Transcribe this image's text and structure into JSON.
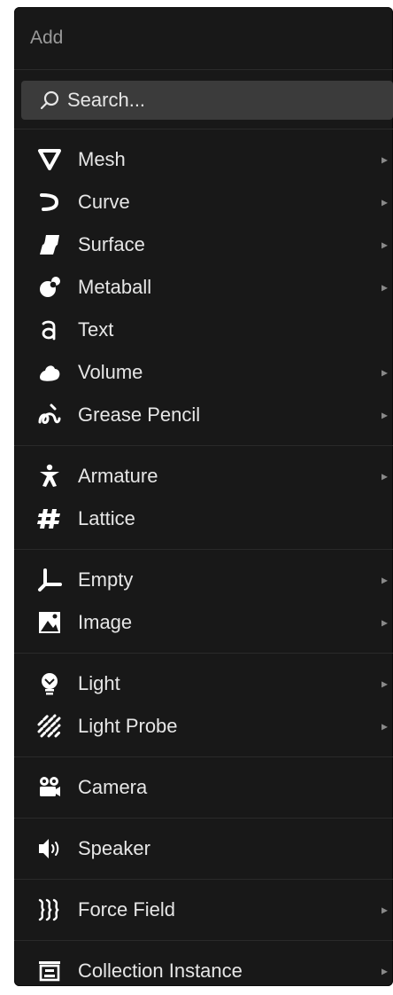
{
  "menu": {
    "title": "Add",
    "search_placeholder": "Search...",
    "groups": [
      {
        "items": [
          {
            "label": "Mesh",
            "icon": "mesh-icon",
            "arrow": "▸"
          },
          {
            "label": "Curve",
            "icon": "curve-icon",
            "arrow": "▸"
          },
          {
            "label": "Surface",
            "icon": "surface-icon",
            "arrow": "▸"
          },
          {
            "label": "Metaball",
            "icon": "metaball-icon",
            "arrow": "▸"
          },
          {
            "label": "Text",
            "icon": "text-icon",
            "arrow": ""
          },
          {
            "label": "Volume",
            "icon": "volume-icon",
            "arrow": "▸"
          },
          {
            "label": "Grease Pencil",
            "icon": "grease-pencil-icon",
            "arrow": "▸"
          }
        ]
      },
      {
        "items": [
          {
            "label": "Armature",
            "icon": "armature-icon",
            "arrow": "▸"
          },
          {
            "label": "Lattice",
            "icon": "lattice-icon",
            "arrow": ""
          }
        ]
      },
      {
        "items": [
          {
            "label": "Empty",
            "icon": "empty-icon",
            "arrow": "▸"
          },
          {
            "label": "Image",
            "icon": "image-icon",
            "arrow": "▸"
          }
        ]
      },
      {
        "items": [
          {
            "label": "Light",
            "icon": "light-icon",
            "arrow": "▸"
          },
          {
            "label": "Light Probe",
            "icon": "light-probe-icon",
            "arrow": "▸"
          }
        ]
      },
      {
        "items": [
          {
            "label": "Camera",
            "icon": "camera-icon",
            "arrow": ""
          }
        ]
      },
      {
        "items": [
          {
            "label": "Speaker",
            "icon": "speaker-icon",
            "arrow": ""
          }
        ]
      },
      {
        "items": [
          {
            "label": "Force Field",
            "icon": "force-field-icon",
            "arrow": "▸"
          }
        ]
      },
      {
        "items": [
          {
            "label": "Collection Instance",
            "icon": "collection-instance-icon",
            "arrow": "▸"
          }
        ]
      }
    ]
  }
}
